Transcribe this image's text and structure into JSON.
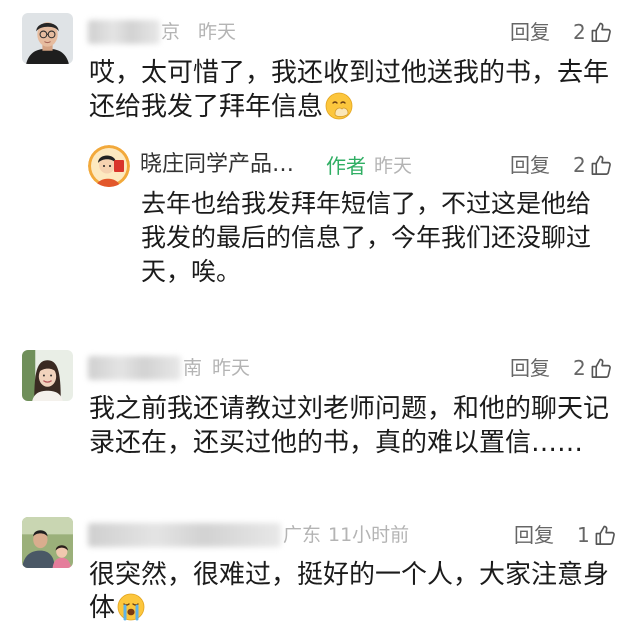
{
  "colors": {
    "background": "#ffffff",
    "text": "#1b1b1b",
    "meta": "#b4b4b4",
    "action": "#666666",
    "author_badge": "#2fae63"
  },
  "comments": [
    {
      "avatar_icon": "man-with-glasses-avatar",
      "location": "京",
      "time": "昨天",
      "reply_label": "回复",
      "likes": "2",
      "like_icon": "thumbs-up-icon",
      "lines": [
        "哎，太可惜了，我还收到过他送我的书，去年",
        "还给我发了拜年信息"
      ],
      "emoji_icon": "hand-over-mouth-emoji",
      "replies": [
        {
          "avatar_icon": "cartoon-student-avatar",
          "name": "晓庄同学产品…",
          "badge": "作者",
          "time": "昨天",
          "reply_label": "回复",
          "likes": "2",
          "like_icon": "thumbs-up-icon",
          "lines": [
            "去年也给我发拜年短信了，不过这是他给",
            "我发的最后的信息了，今年我们还没聊过",
            "天，唉。"
          ]
        }
      ]
    },
    {
      "avatar_icon": "woman-portrait-avatar",
      "location": "南",
      "time": "昨天",
      "reply_label": "回复",
      "likes": "2",
      "like_icon": "thumbs-up-icon",
      "lines": [
        "我之前我还请教过刘老师问题，和他的聊天记",
        "录还在，还买过他的书，真的难以置信……"
      ]
    },
    {
      "avatar_icon": "man-with-child-avatar",
      "location": "广东",
      "time": "11小时前",
      "reply_label": "回复",
      "likes": "1",
      "like_icon": "thumbs-up-icon",
      "lines": [
        "很突然，很难过，挺好的一个人，大家注意身",
        "体"
      ],
      "emoji_icon": "loudly-crying-emoji"
    }
  ]
}
